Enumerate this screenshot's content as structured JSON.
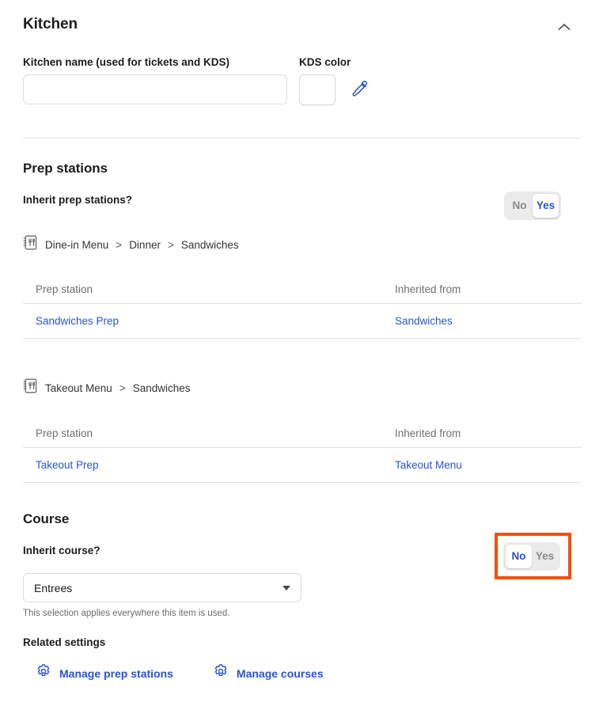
{
  "section": {
    "title": "Kitchen",
    "collapse_icon": "chevron-up-icon"
  },
  "kitchen_name": {
    "label": "Kitchen name (used for tickets and KDS)",
    "value": "",
    "placeholder": ""
  },
  "kds_color": {
    "label": "KDS color",
    "swatch_color": "#ffffff",
    "eyedropper_icon": "eyedropper-icon"
  },
  "prep_stations": {
    "title": "Prep stations",
    "inherit_label": "Inherit prep stations?",
    "toggle": {
      "options": [
        "No",
        "Yes"
      ],
      "selected": "Yes"
    },
    "groups": [
      {
        "menu_icon": "menu-book-icon",
        "breadcrumb": [
          "Dine-in Menu",
          "Dinner",
          "Sandwiches"
        ],
        "separator": ">",
        "columns": [
          "Prep station",
          "Inherited from"
        ],
        "rows": [
          {
            "prep_station": "Sandwiches Prep",
            "inherited_from": "Sandwiches"
          }
        ]
      },
      {
        "menu_icon": "menu-book-icon",
        "breadcrumb": [
          "Takeout Menu",
          "Sandwiches"
        ],
        "separator": ">",
        "columns": [
          "Prep station",
          "Inherited from"
        ],
        "rows": [
          {
            "prep_station": "Takeout Prep",
            "inherited_from": "Takeout Menu"
          }
        ]
      }
    ]
  },
  "course": {
    "title": "Course",
    "inherit_label": "Inherit course?",
    "toggle": {
      "options": [
        "No",
        "Yes"
      ],
      "selected": "No",
      "highlighted": true,
      "highlight_color": "#f2500a"
    },
    "select": {
      "value": "Entrees",
      "help_text": "This selection applies everywhere this item is used."
    }
  },
  "related_settings": {
    "title": "Related settings",
    "links": [
      {
        "icon": "gear-icon",
        "label": "Manage prep stations"
      },
      {
        "icon": "gear-icon",
        "label": "Manage courses"
      }
    ]
  },
  "colors": {
    "link_blue": "#2b52d6",
    "accent_orange": "#f2500a",
    "text_dark": "#1c1c1c",
    "text_muted": "#6f6f6f"
  }
}
